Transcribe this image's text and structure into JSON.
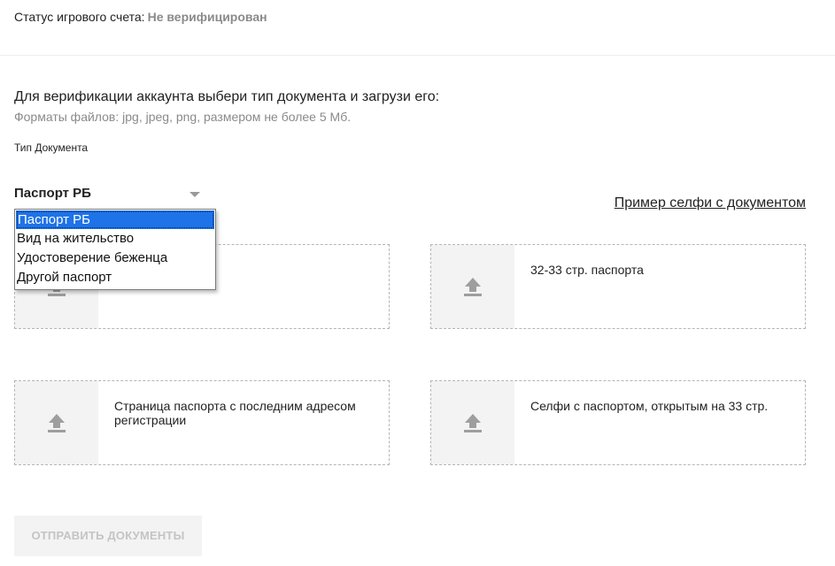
{
  "status": {
    "label": "Статус игрового счета:",
    "value": "Не верифицирован",
    "value_color": "#8a8a8a",
    "underline_color": "#e0141e"
  },
  "intro": {
    "title": "Для верификации аккаунта выбери тип документа и загрузи его:",
    "formats": "Форматы файлов: jpg, jpeg, png, размером не более 5 Мб."
  },
  "doc_type": {
    "label": "Тип Документа",
    "selected": "Паспорт РБ",
    "options": [
      "Паспорт РБ",
      "Вид на жительство",
      "Удостоверение беженца",
      "Другой паспорт"
    ],
    "highlight_color": "#1e73e8"
  },
  "selfie_example_link": "Пример селфи с документом",
  "uploads": [
    {
      "label": "",
      "icon": "upload-icon"
    },
    {
      "label": "32-33 стр. паспорта",
      "icon": "upload-icon"
    },
    {
      "label": "Страница паспорта с последним адресом регистрации",
      "icon": "upload-icon"
    },
    {
      "label": "Селфи с паспортом, открытым на 33 стр.",
      "icon": "upload-icon"
    }
  ],
  "submit_button": "ОТПРАВИТЬ ДОКУМЕНТЫ"
}
